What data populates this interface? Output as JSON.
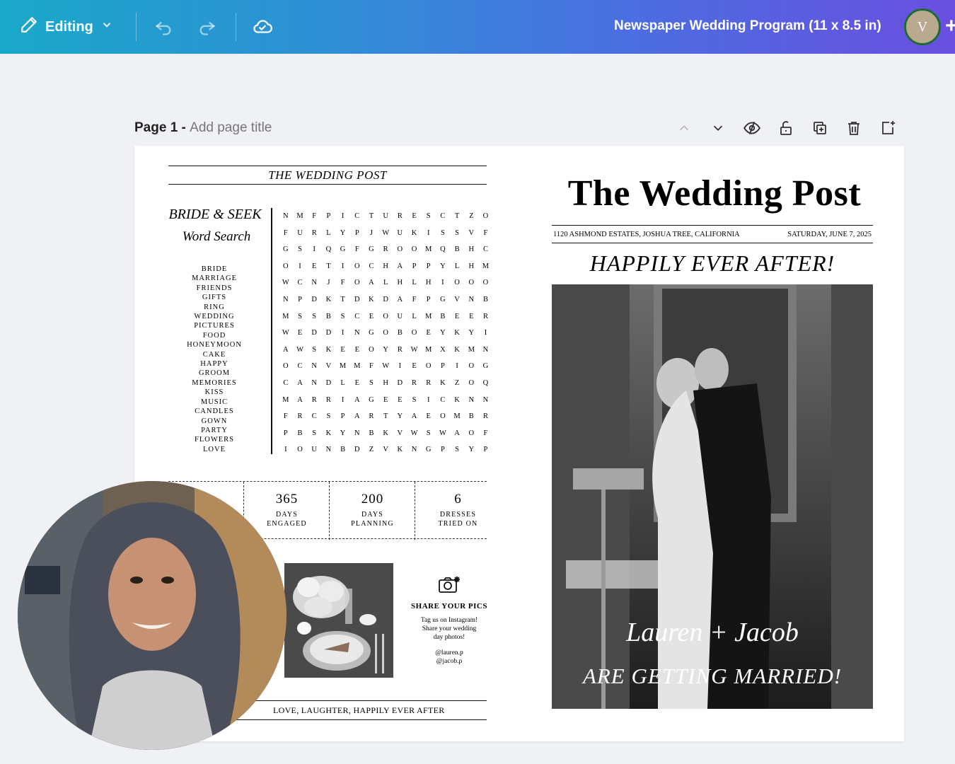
{
  "topbar": {
    "mode_label": "Editing",
    "doc_title": "Newspaper Wedding Program (11 x 8.5 in)",
    "avatar_initial": "V",
    "plus": "+"
  },
  "page_header": {
    "page_label": "Page 1 - ",
    "title_placeholder": "Add page title"
  },
  "left_page": {
    "masthead": "THE WEDDING POST",
    "game_title": "BRIDE & SEEK",
    "game_subtitle": "Word Search",
    "word_list": [
      "BRIDE",
      "MARRIAGE",
      "FRIENDS",
      "GIFTS",
      "RING",
      "WEDDING",
      "PICTURES",
      "FOOD",
      "HONEYMOON",
      "CAKE",
      "HAPPY",
      "GROOM",
      "MEMORIES",
      "KISS",
      "MUSIC",
      "CANDLES",
      "GOWN",
      "PARTY",
      "FLOWERS",
      "LOVE"
    ],
    "grid": [
      "NMFPICTURESCTZO",
      "FURLYPJWUKISSVF",
      "GSIQGFGROOMQBHC",
      "OIETIOCHAPPYLHM",
      "WCNJFOALHLHIOOO",
      "NPDKTDKDAFPGVNB",
      "MSSBSCEOULMBEER",
      "WEDDINGOBOEYKYI",
      "AWSKEEOYRWMXKMN",
      "OCNVMMFWIEOPIOG",
      "CANDLESHDRRKZOQ",
      "MARRIAGEESICKNN",
      "FRCSPARTYAEOMBR",
      "PBSKYNBKVWSWAOF",
      "IOUNBDZVKNGPSYP"
    ],
    "stats": [
      {
        "num": "365",
        "label": "DAYS\nENGAGED"
      },
      {
        "num": "200",
        "label": "DAYS\nPLANNING"
      },
      {
        "num": "6",
        "label": "DRESSES\nTRIED ON"
      }
    ],
    "share_title": "SHARE YOUR PICS",
    "share_body": "Tag us on Instagram!\nShare your wedding\nday photos!",
    "share_handles": "@lauren.p\n@jacob.p",
    "footer": "LOVE, LAUGHTER, HAPPILY EVER AFTER"
  },
  "right_page": {
    "title": "The Wedding Post",
    "address": "1120 ASHMOND ESTATES, JOSHUA TREE, CALIFORNIA",
    "date": "SATURDAY, JUNE 7, 2025",
    "headline": "HAPPILY EVER AFTER!",
    "names": "Lauren + Jacob",
    "tagline": "ARE GETTING MARRIED!"
  }
}
